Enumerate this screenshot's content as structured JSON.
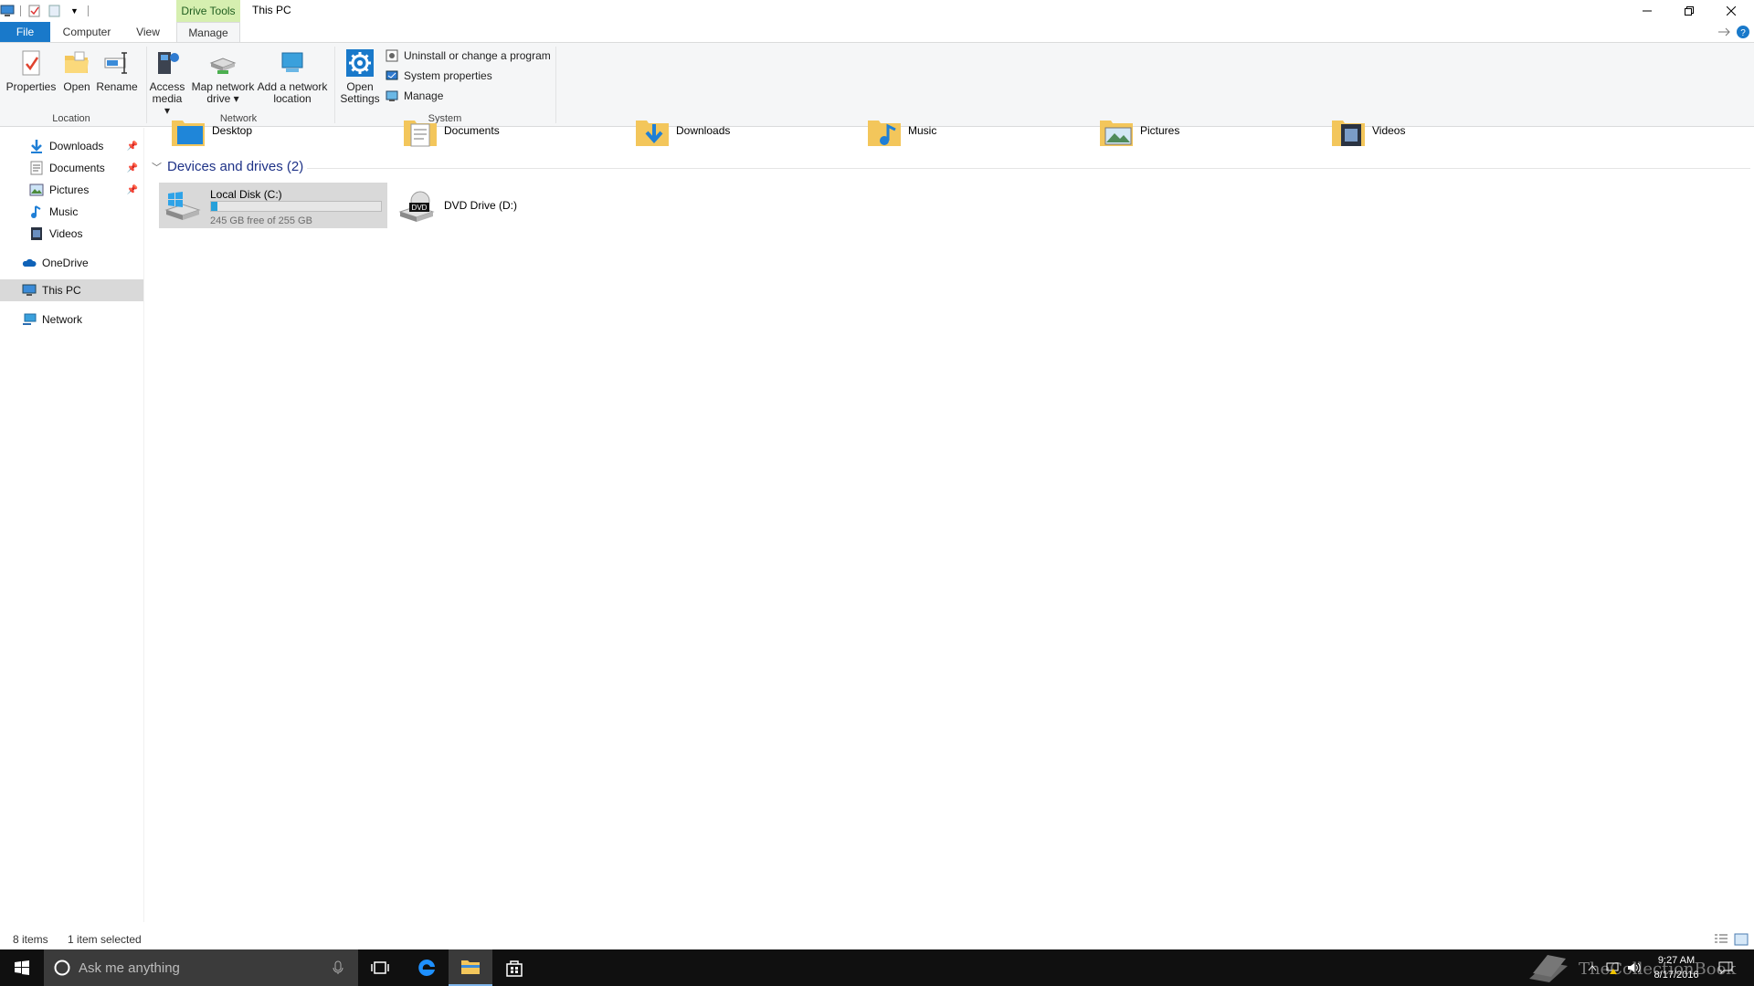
{
  "window": {
    "title": "This PC",
    "contextual_tab": "Drive Tools"
  },
  "tabs": [
    {
      "label": "File"
    },
    {
      "label": "Computer"
    },
    {
      "label": "View"
    },
    {
      "label": "Manage"
    }
  ],
  "ribbon": {
    "location": {
      "label": "Location",
      "buttons": [
        {
          "label": "Properties",
          "icon": "properties-icon"
        },
        {
          "label": "Open",
          "icon": "open-folder-icon"
        },
        {
          "label": "Rename",
          "icon": "rename-icon"
        }
      ]
    },
    "network": {
      "label": "Network",
      "buttons": [
        {
          "label": "Access media",
          "line1": "Access",
          "line2": "media ▾",
          "icon": "access-media-icon"
        },
        {
          "label": "Map network drive",
          "line1": "Map network",
          "line2": "drive ▾",
          "icon": "map-network-drive-icon"
        },
        {
          "label": "Add a network location",
          "line1": "Add a network",
          "line2": "location",
          "icon": "add-network-location-icon"
        }
      ]
    },
    "system": {
      "label": "System",
      "open_settings": {
        "line1": "Open",
        "line2": "Settings",
        "icon": "gear-icon"
      },
      "small_buttons": [
        {
          "label": "Uninstall or change a program",
          "icon": "uninstall-icon"
        },
        {
          "label": "System properties",
          "icon": "system-properties-icon"
        },
        {
          "label": "Manage",
          "icon": "manage-icon"
        }
      ]
    }
  },
  "nav": {
    "items": [
      {
        "label": "Downloads",
        "icon": "download-arrow-icon",
        "pinned": true
      },
      {
        "label": "Documents",
        "icon": "documents-icon",
        "pinned": true
      },
      {
        "label": "Pictures",
        "icon": "pictures-icon",
        "pinned": true
      },
      {
        "label": "Music",
        "icon": "music-note-icon",
        "pinned": false
      },
      {
        "label": "Videos",
        "icon": "videos-icon",
        "pinned": false
      },
      {
        "label": "OneDrive",
        "icon": "onedrive-cloud-icon"
      },
      {
        "label": "This PC",
        "icon": "computer-icon",
        "selected": true
      },
      {
        "label": "Network",
        "icon": "network-icon"
      }
    ]
  },
  "folders": [
    {
      "label": "Desktop",
      "icon": "desktop-folder-icon"
    },
    {
      "label": "Documents",
      "icon": "documents-folder-icon"
    },
    {
      "label": "Downloads",
      "icon": "downloads-folder-icon"
    },
    {
      "label": "Music",
      "icon": "music-folder-icon"
    },
    {
      "label": "Pictures",
      "icon": "pictures-folder-icon"
    },
    {
      "label": "Videos",
      "icon": "videos-folder-icon"
    }
  ],
  "devices": {
    "header": "Devices and drives (2)",
    "drives": [
      {
        "name": "Local Disk (C:)",
        "free_text": "245 GB free of 255 GB",
        "used_fraction": 0.04,
        "selected": true,
        "icon": "windows-drive-icon"
      },
      {
        "name": "DVD Drive (D:)",
        "icon": "dvd-drive-icon",
        "selected": false
      }
    ]
  },
  "status": {
    "items": "8 items",
    "selection": "1 item selected"
  },
  "taskbar": {
    "search_placeholder": "Ask me anything",
    "time": "9:27 AM",
    "date": "8/17/2016",
    "watermark": "TheCollectionBook",
    "apps": [
      "task-view-icon",
      "edge-icon",
      "file-explorer-icon",
      "store-icon"
    ]
  },
  "colors": {
    "accent": "#1979ca",
    "selection": "#d9d9d9",
    "group_header": "#1e3287",
    "drive_bar": "#26a0da",
    "contextual": "#d6efb0"
  }
}
